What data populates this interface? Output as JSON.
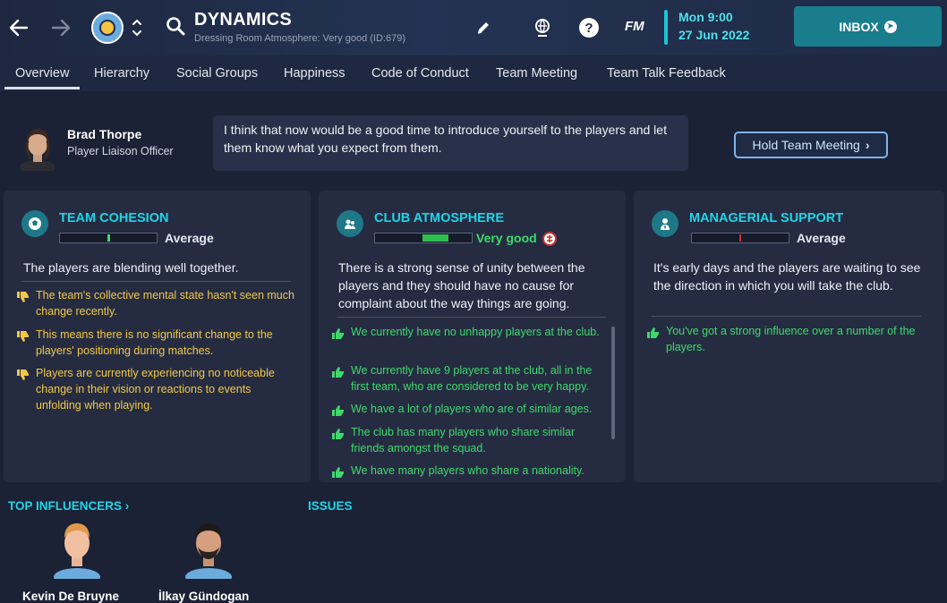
{
  "header": {
    "title": "DYNAMICS",
    "subtitle": "Dressing Room Atmosphere: Very good (ID:679)",
    "fm_logo": "FM",
    "time": "Mon 9:00",
    "date": "27 Jun 2022",
    "inbox_label": "INBOX",
    "accent_color": "#1a7d8e"
  },
  "tabs": [
    {
      "label": "Overview",
      "active": true
    },
    {
      "label": "Hierarchy"
    },
    {
      "label": "Social Groups"
    },
    {
      "label": "Happiness"
    },
    {
      "label": "Code of Conduct"
    },
    {
      "label": "Team Meeting"
    },
    {
      "label": "Team Talk Feedback"
    }
  ],
  "liaison": {
    "name": "Brad Thorpe",
    "role": "Player Liaison Officer",
    "message": "I think that now would be a good time to introduce yourself to the players and let them know what you expect from them.",
    "button_label": "Hold Team Meeting"
  },
  "panels": [
    {
      "title": "TEAM COHESION",
      "rating": "Average",
      "level": 0.5,
      "summary": "The players are blending well together.",
      "facts": [
        "The team's collective mental state hasn't seen much change recently.",
        "This means there is no significant change to the players' positioning during matches.",
        "Players are currently experiencing no noticeable change in their vision or reactions to events unfolding when playing."
      ]
    },
    {
      "title": "CLUB ATMOSPHERE",
      "rating": "Very good",
      "level": 0.75,
      "summary": "There is a strong sense of unity between the players and they should have no cause for complaint about the way things are going.",
      "facts": [
        "We currently have no unhappy players at the club.",
        "We currently have 9 players at the club, all in the first team, who are considered to be very happy.",
        "We have a lot of players who are of similar ages.",
        "The club has many players who share similar friends amongst the squad.",
        "We have many players who share a nationality."
      ]
    },
    {
      "title": "MANAGERIAL SUPPORT",
      "rating": "Average",
      "level": 0.5,
      "summary": "It's early days and the players are waiting to see the direction in which you will take the club.",
      "facts": [
        "You've got a strong influence over a number of the players."
      ]
    }
  ],
  "bottom": {
    "influencers_title": "TOP INFLUENCERS",
    "issues_title": "ISSUES",
    "influencers": [
      "Kevin De Bruyne",
      "İlkay Gündogan"
    ]
  }
}
